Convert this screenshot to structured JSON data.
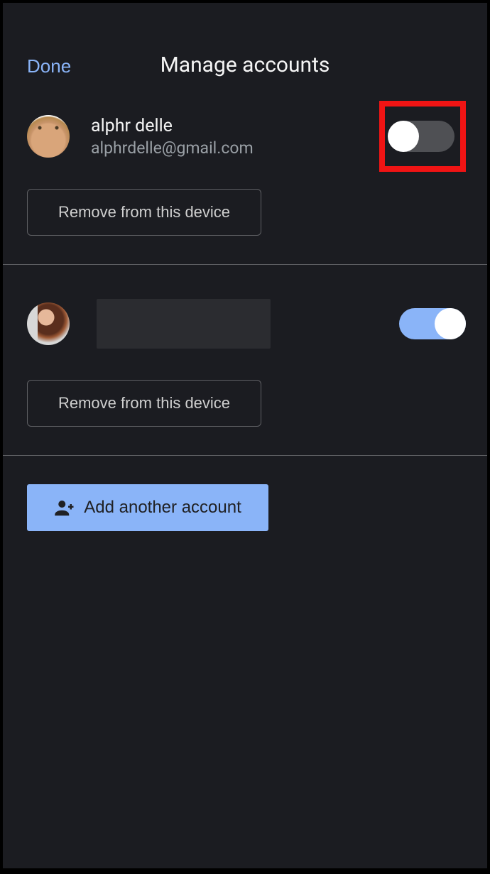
{
  "header": {
    "done_label": "Done",
    "title": "Manage accounts"
  },
  "accounts": [
    {
      "name": "alphr delle",
      "email": "alphrdelle@gmail.com",
      "enabled": false,
      "highlighted": true,
      "redacted": false,
      "avatar_kind": "cat",
      "remove_label": "Remove from this device"
    },
    {
      "name": "",
      "email": "",
      "enabled": true,
      "highlighted": false,
      "redacted": true,
      "avatar_kind": "woman",
      "remove_label": "Remove from this device"
    }
  ],
  "add_account_label": "Add another account",
  "colors": {
    "background": "#1b1c21",
    "accent": "#8ab4f8",
    "highlight": "#f01414"
  }
}
